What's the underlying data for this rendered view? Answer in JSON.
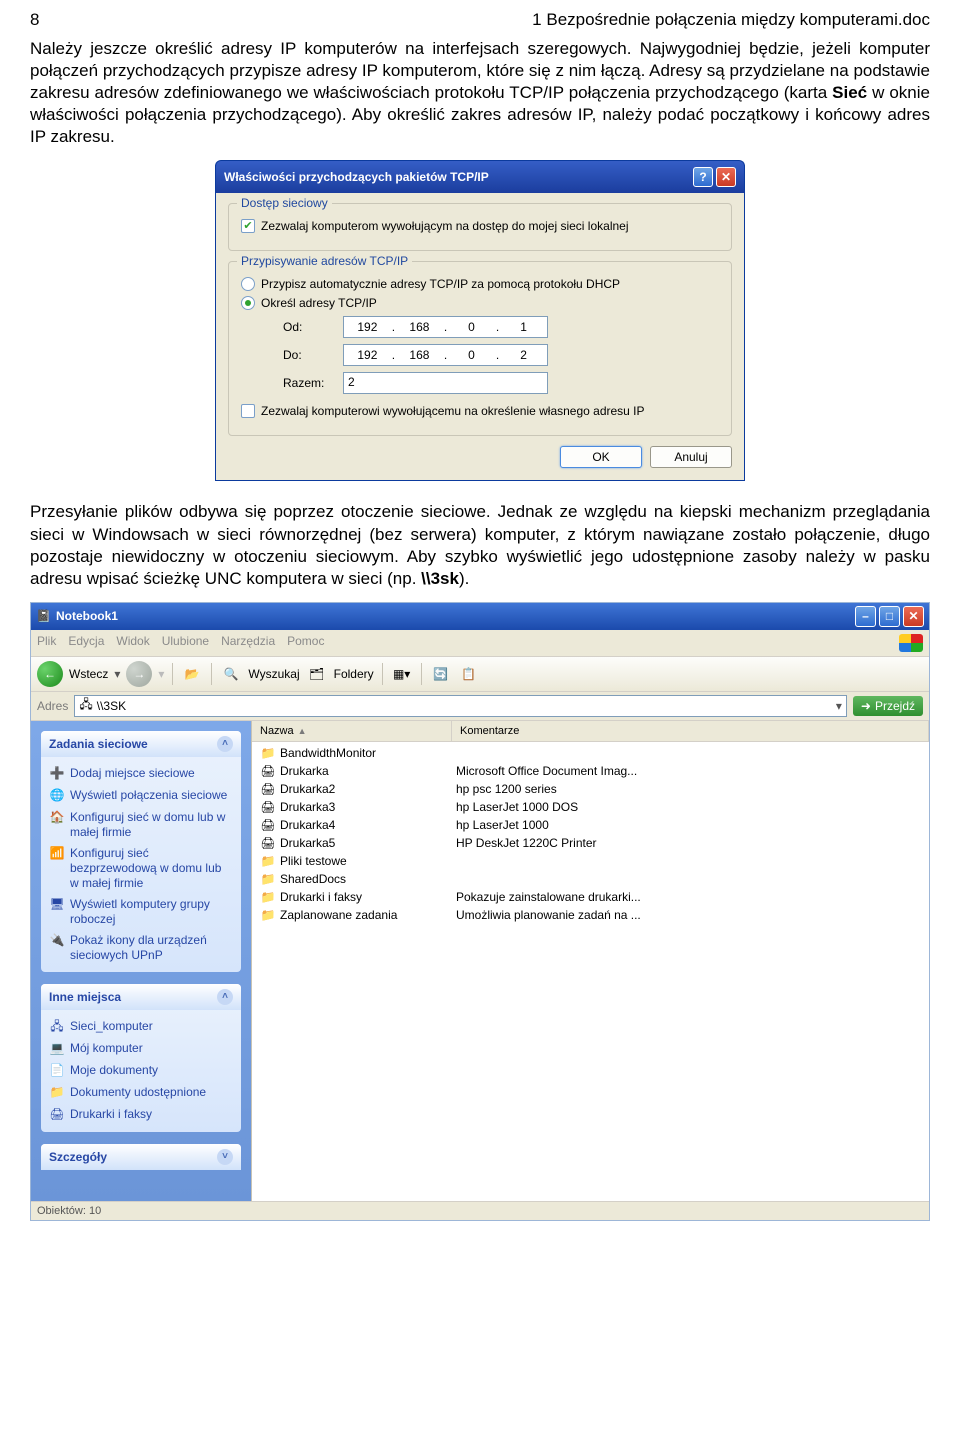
{
  "page": {
    "num": "8",
    "header": "1 Bezpośrednie połączenia między komputerami.doc"
  },
  "para1a": "Należy jeszcze określić adresy IP komputerów na interfejsach szeregowych. Najwygodniej będzie, jeżeli komputer połączeń przychodzących przypisze adresy IP komputerom, które się z nim łączą. Adresy są przydzielane na podstawie zakresu adresów zdefiniowanego we właściwościach protokołu TCP/IP połączenia przychodzącego (karta ",
  "para1b": "Sieć",
  "para1c": " w oknie właściwości połączenia przychodzącego). Aby określić zakres adresów IP, należy podać początkowy i końcowy adres IP zakresu.",
  "dialog": {
    "title": "Właściwości przychodzących pakietów TCP/IP",
    "group1": {
      "legend": "Dostęp sieciowy",
      "chk": "Zezwalaj komputerom wywołującym na dostęp do mojej sieci lokalnej"
    },
    "group2": {
      "legend": "Przypisywanie adresów TCP/IP",
      "opt1": "Przypisz automatycznie adresy TCP/IP za pomocą protokołu DHCP",
      "opt2": "Określ adresy TCP/IP",
      "from": "Od:",
      "to": "Do:",
      "total": "Razem:",
      "ip_from": {
        "a": "192",
        "b": "168",
        "c": "0",
        "d": "1"
      },
      "ip_to": {
        "a": "192",
        "b": "168",
        "c": "0",
        "d": "2"
      },
      "total_val": "2",
      "chk2": "Zezwalaj komputerowi wywołującemu na określenie własnego adresu IP"
    },
    "ok": "OK",
    "cancel": "Anuluj"
  },
  "para2a": "Przesyłanie plików odbywa się poprzez otoczenie sieciowe. Jednak ze względu na kiepski mechanizm przeglądania sieci w Windowsach w sieci równorzędnej (bez serwera) komputer, z którym nawiązane zostało połączenie, długo pozostaje niewidoczny w otoczeniu sieciowym. Aby szybko wyświetlić jego udostępnione zasoby należy w pasku adresu wpisać ścieżkę UNC komputera w sieci (np. ",
  "para2b": "\\\\3sk",
  "para2c": ").",
  "exp": {
    "title": "Notebook1",
    "menu": [
      "Plik",
      "Edycja",
      "Widok",
      "Ulubione",
      "Narzędzia",
      "Pomoc"
    ],
    "back": "Wstecz",
    "search": "Wyszukaj",
    "folders": "Foldery",
    "addr_lbl": "Adres",
    "addr_val": "\\\\3SK",
    "go": "Przejdź",
    "panel1": {
      "title": "Zadania sieciowe",
      "items": [
        "Dodaj miejsce sieciowe",
        "Wyświetl połączenia sieciowe",
        "Konfiguruj sieć w domu lub w małej firmie",
        "Konfiguruj sieć bezprzewodową w domu lub w małej firmie",
        "Wyświetl komputery grupy roboczej",
        "Pokaż ikony dla urządzeń sieciowych UPnP"
      ]
    },
    "panel2": {
      "title": "Inne miejsca",
      "items": [
        "Sieci_komputer",
        "Mój komputer",
        "Moje dokumenty",
        "Dokumenty udostępnione",
        "Drukarki i faksy"
      ]
    },
    "panel3": {
      "title": "Szczegóły"
    },
    "cols": {
      "name": "Nazwa",
      "comment": "Komentarze"
    },
    "rows": [
      {
        "n": "BandwidthMonitor",
        "c": "",
        "t": "f"
      },
      {
        "n": "Drukarka",
        "c": "Microsoft Office Document Imag...",
        "t": "p"
      },
      {
        "n": "Drukarka2",
        "c": "hp psc 1200 series",
        "t": "p"
      },
      {
        "n": "Drukarka3",
        "c": "hp LaserJet 1000 DOS",
        "t": "p"
      },
      {
        "n": "Drukarka4",
        "c": "hp LaserJet 1000",
        "t": "p"
      },
      {
        "n": "Drukarka5",
        "c": "HP DeskJet 1220C Printer",
        "t": "p"
      },
      {
        "n": "Pliki testowe",
        "c": "",
        "t": "f"
      },
      {
        "n": "SharedDocs",
        "c": "",
        "t": "f"
      },
      {
        "n": "Drukarki i faksy",
        "c": "Pokazuje zainstalowane drukarki...",
        "t": "f"
      },
      {
        "n": "Zaplanowane zadania",
        "c": "Umożliwia planowanie zadań na ...",
        "t": "f"
      }
    ],
    "status": "Obiektów: 10"
  }
}
